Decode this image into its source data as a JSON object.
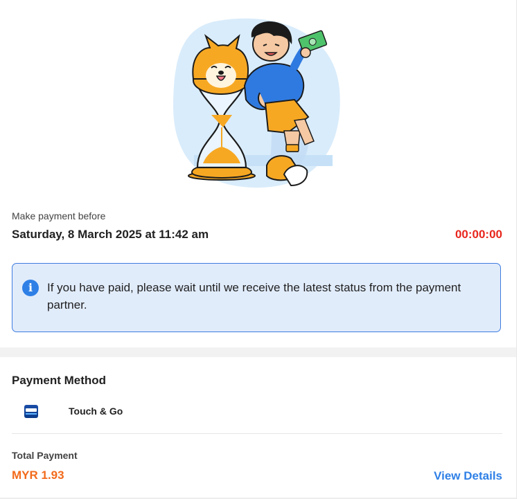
{
  "illustration": {
    "name": "hourglass-waiting-illustration",
    "colors": {
      "blob": "#d9ecfb",
      "orange": "#f7a823",
      "blue": "#2f7ae0",
      "money": "#4fc36b"
    }
  },
  "deadline": {
    "label": "Make payment before",
    "date": "Saturday, 8 March 2025 at 11:42 am",
    "countdown": "00:00:00"
  },
  "notice": {
    "icon": "info-icon",
    "message": "If you have paid, please wait until we receive the latest status from the payment partner."
  },
  "payment_method": {
    "title": "Payment Method",
    "method": {
      "icon": "touch-n-go-logo",
      "name": "Touch & Go"
    }
  },
  "total": {
    "label": "Total Payment",
    "amount": "MYR 1.93",
    "view_details": "View Details"
  },
  "colors": {
    "countdown": "#e8261d",
    "amount": "#f26a1b",
    "link": "#2f80e6",
    "notice_bg": "#e1ecfb",
    "notice_border": "#3e7be0"
  }
}
